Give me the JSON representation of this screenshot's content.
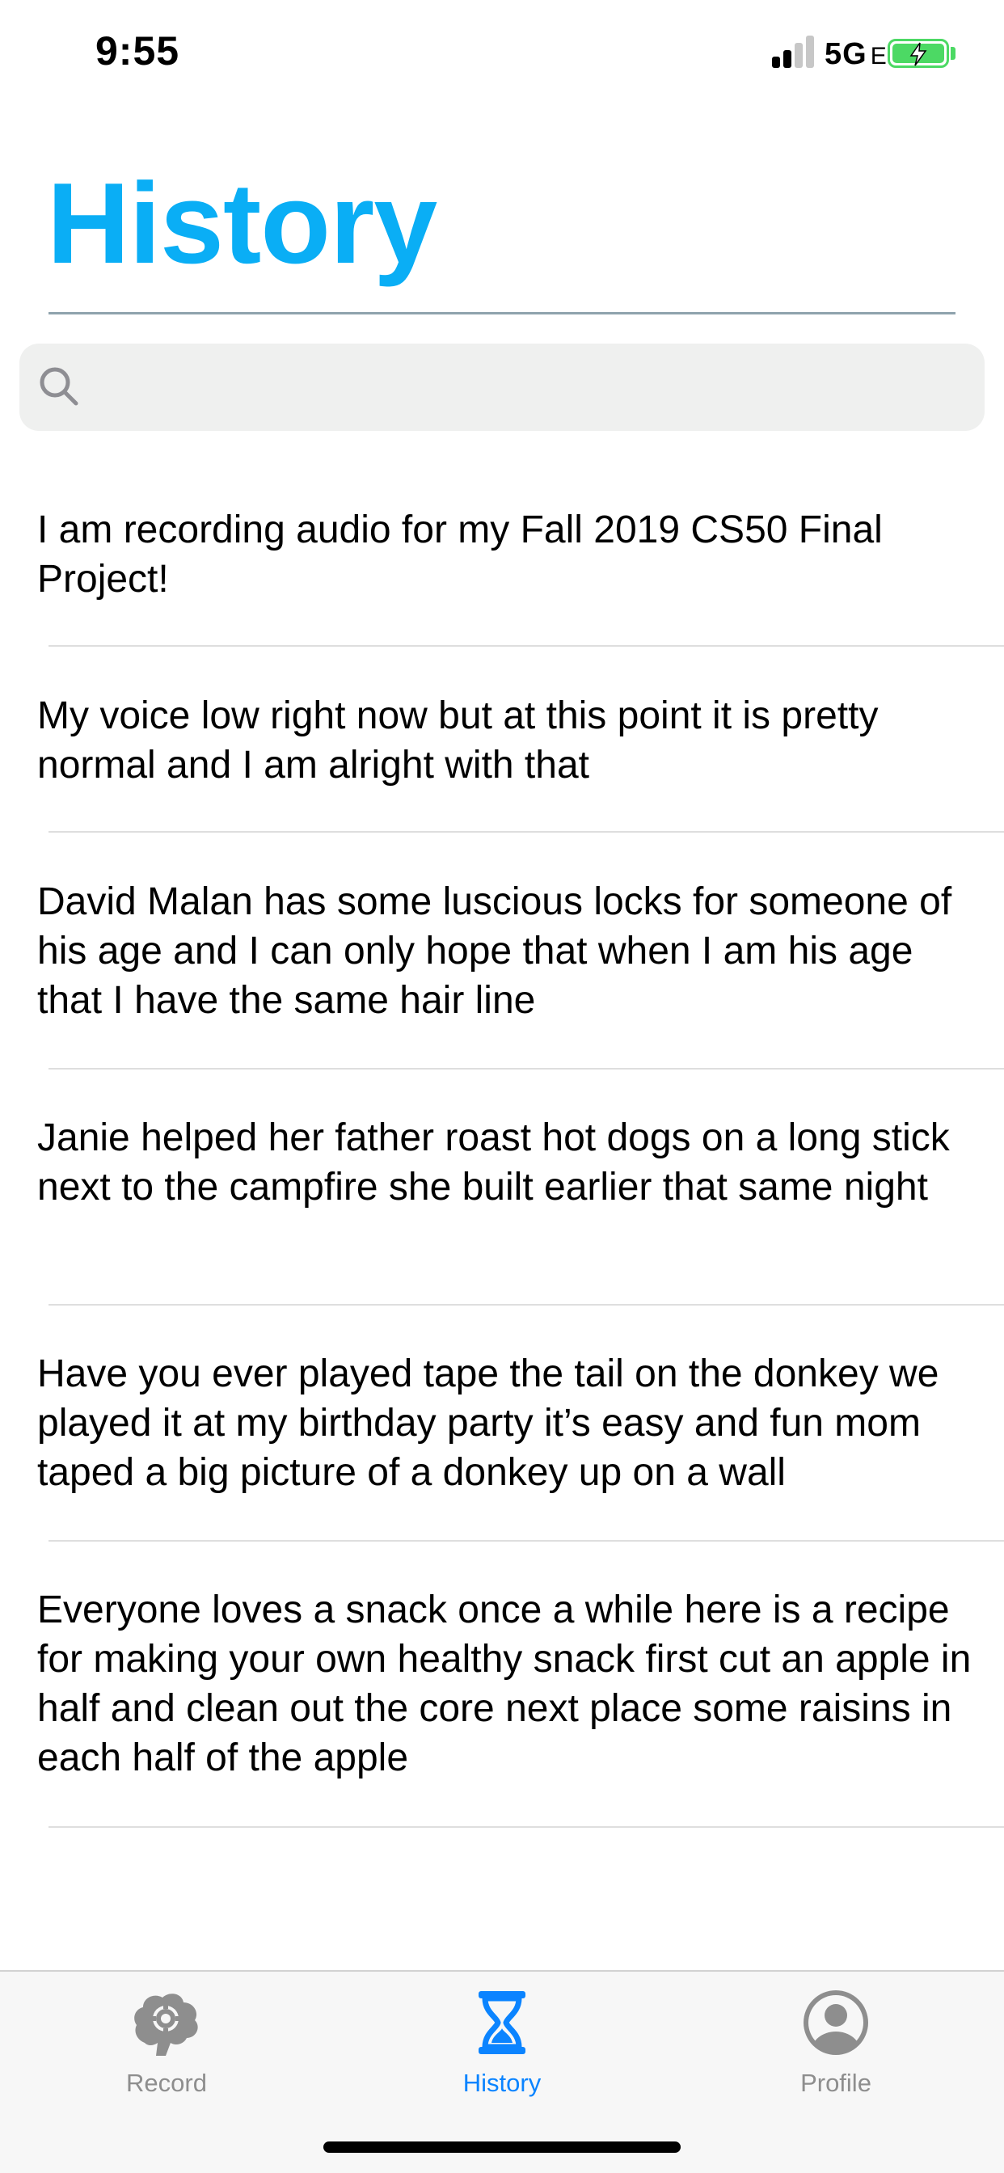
{
  "status_bar": {
    "time": "9:55",
    "network": "5G",
    "network_suffix": "E",
    "battery_color": "#4cd964"
  },
  "header": {
    "title": "History",
    "title_color": "#0aaef5"
  },
  "search": {
    "value": "",
    "placeholder": "",
    "icon": "search-icon"
  },
  "history": {
    "items": [
      {
        "text": "I am recording audio for my Fall 2019 CS50 Final Project!"
      },
      {
        "text": "My voice low right now but at this point it is pretty normal and I am alright with that"
      },
      {
        "text": "David Malan has some luscious locks for someone of his age and I can only hope that when I am his age that I have the same hair line"
      },
      {
        "text": "Janie helped her father roast hot dogs on a long stick next to the campfire she built earlier that same night"
      },
      {
        "text": "Have you ever played tape the tail on the donkey we played it at my birthday party it’s easy and fun mom taped a big picture of a donkey up on a wall"
      },
      {
        "text": "Everyone loves a snack once a while here is a recipe for making your own healthy snack first cut an apple in half and clean out the core next place some raisins in each half of the apple"
      }
    ]
  },
  "tab_bar": {
    "active_color": "#0b84ff",
    "inactive_color": "#8e8e8e",
    "tabs": [
      {
        "label": "Record",
        "icon": "brain-gear-icon",
        "active": false
      },
      {
        "label": "History",
        "icon": "hourglass-icon",
        "active": true
      },
      {
        "label": "Profile",
        "icon": "person-circle-icon",
        "active": false
      }
    ]
  }
}
